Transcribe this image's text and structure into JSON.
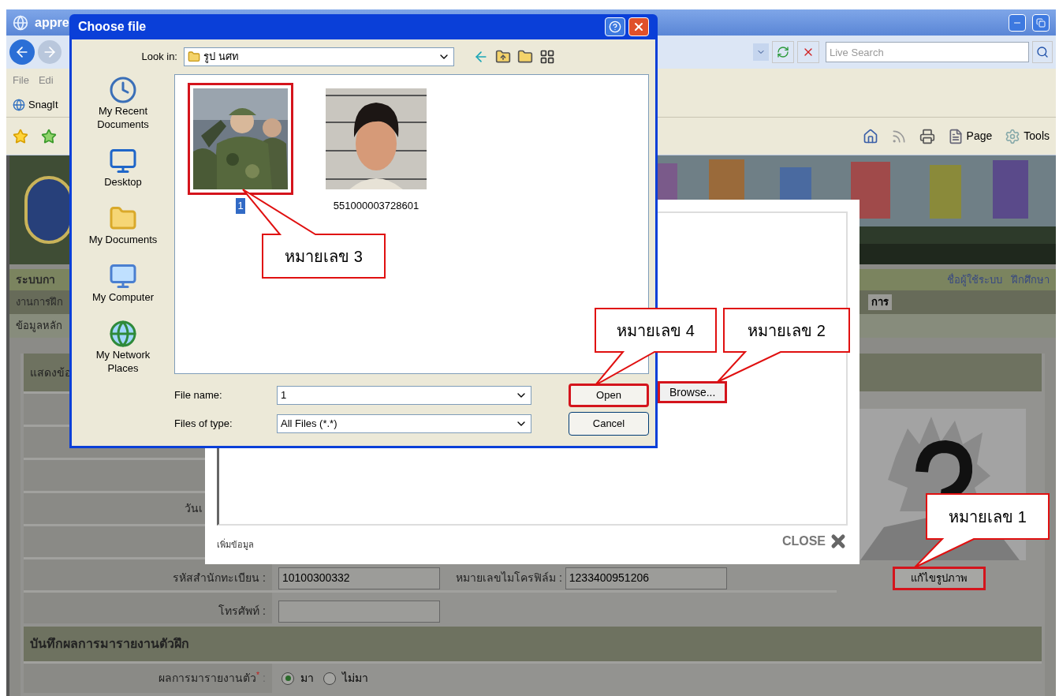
{
  "browser": {
    "title": "appre",
    "search": {
      "placeholder": "Live Search"
    },
    "menu": [
      "File",
      "Edi"
    ],
    "toolbar_button": "SnagIt",
    "command_bar": [
      "Page",
      "Tools"
    ]
  },
  "page": {
    "system_name": "ระบบกา",
    "user_links": [
      "ชื่อผู้ใช้ระบบ",
      "ฝึกศึกษา"
    ],
    "menu_left": "งานการฝึก",
    "menu_right": "การ",
    "breadcrumb": "ข้อมูลหลัก",
    "section_1": {
      "title": "แสดงข้อ",
      "rows": [
        {
          "label": ""
        },
        {
          "label": ""
        },
        {
          "label": ""
        },
        {
          "label": "วันเ"
        },
        {
          "label": ""
        },
        {
          "label": "รหัสสำนักทะเบียน :",
          "value": "10100300332",
          "label_2": "หมายเลขไมโครฟิล์ม :",
          "value_2": "1233400951206"
        },
        {
          "label": "โทรศัพท์ :",
          "value": ""
        }
      ],
      "edit_photo_button": {
        "label": "แก้ไขรูปภาพ",
        "highlighted": true
      }
    },
    "section_2": {
      "title": "บันทึกผลการมารายงานตัวฝึก",
      "field": {
        "label": "ผลการมารายงานตัว",
        "required_mark": "*",
        "colon": ":",
        "options": [
          {
            "label": "มา",
            "selected": true
          },
          {
            "label": "ไม่มา",
            "selected": false
          }
        ]
      }
    }
  },
  "modal": {
    "browse_button": {
      "label": "Browse...",
      "highlighted": true
    },
    "add_link": "เพิ่มข้อมูล",
    "close": "CLOSE"
  },
  "dialog": {
    "title": "Choose file",
    "look_in_label": "Look in:",
    "look_in": "รูป นศท",
    "places": [
      {
        "label": "My Recent Documents",
        "kind": "recent"
      },
      {
        "label": "Desktop",
        "kind": "desktop"
      },
      {
        "label": "My Documents",
        "kind": "documents"
      },
      {
        "label": "My Computer",
        "kind": "computer"
      },
      {
        "label": "My Network Places",
        "kind": "network"
      }
    ],
    "files": [
      {
        "name": "1",
        "selected": true,
        "highlighted": true,
        "kind": "picture"
      },
      {
        "name": "551000003728601",
        "selected": false,
        "highlighted": false,
        "kind": "picture"
      }
    ],
    "file_name_label": "File name:",
    "file_name": "1",
    "file_type_label": "Files of type:",
    "file_type": "All Files (*.*)",
    "buttons": [
      {
        "label": "Open",
        "highlighted": true
      },
      {
        "label": "Cancel",
        "highlighted": false
      }
    ]
  },
  "callouts": [
    "หมายเลข 3",
    "หมายเลข 4",
    "หมายเลข 2",
    "หมายเลข 1"
  ]
}
